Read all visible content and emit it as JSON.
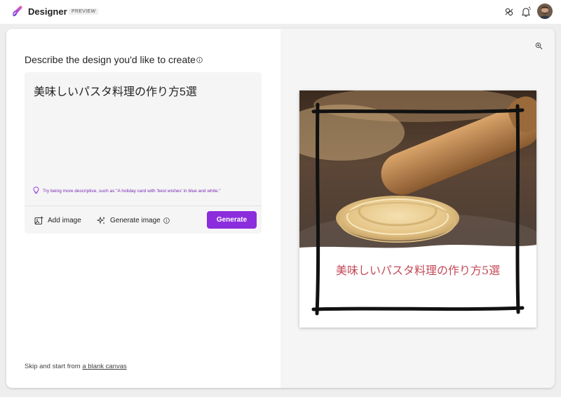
{
  "app": {
    "title": "Designer",
    "badge": "PREVIEW"
  },
  "header_icons": [
    "share-icon",
    "notifications-icon",
    "avatar"
  ],
  "left_panel": {
    "heading": "Describe the design you'd like to create",
    "prompt_value": "美味しいパスタ料理の作り方5選",
    "hint": "Try being more descriptive, such as \"A holiday card with 'best wishes' in blue and white.\"",
    "add_image_label": "Add image",
    "generate_image_label": "Generate image",
    "generate_button_label": "Generate",
    "skip_prefix": "Skip and start from ",
    "skip_link": "a blank canvas"
  },
  "preview": {
    "title": "美味しいパスタ料理の作り方5選"
  },
  "colors": {
    "accent": "#8b2ddc",
    "hint_text": "#7a2ab5",
    "preview_title": "#c44a58"
  }
}
